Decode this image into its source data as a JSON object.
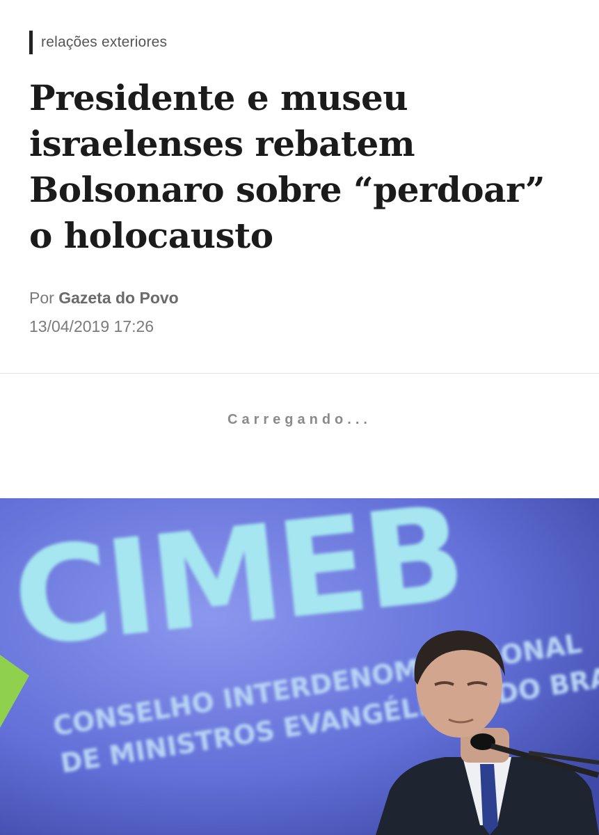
{
  "article": {
    "section": "relações exteriores",
    "headline": "Presidente e museu israelenses rebatem Bolsonaro sobre “perdoar” o holocausto",
    "byline_prefix": "Por",
    "author": "Gazeta do Povo",
    "timestamp": "13/04/2019 17:26"
  },
  "status": {
    "loading_text": "Carregando..."
  },
  "photo": {
    "logo_text": "CIMEB",
    "banner_line_1": "CONSELHO INTERDENOMINACIONAL",
    "banner_line_2": "DE MINISTROS EVANGÉLICOS DO BRASIL",
    "colors": {
      "background": "#5e6bd6",
      "logo": "#9fe3ee",
      "accent": "#8fd14f"
    }
  }
}
